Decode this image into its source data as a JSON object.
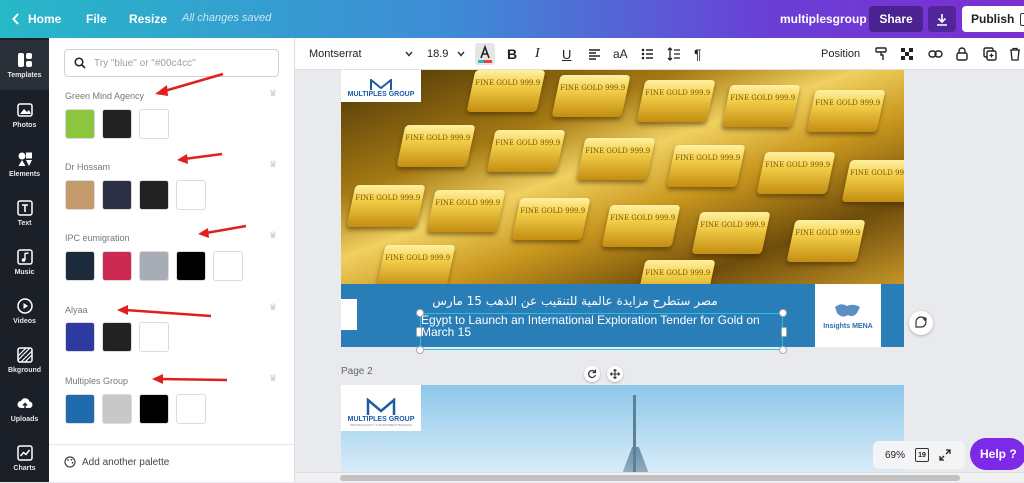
{
  "topbar": {
    "home_label": "Home",
    "file_label": "File",
    "resize_label": "Resize",
    "save_status": "All changes saved",
    "project_name": "multiplesgroup",
    "share_label": "Share",
    "publish_label": "Publish"
  },
  "rail": [
    {
      "label": "Templates",
      "icon": "templates-icon"
    },
    {
      "label": "Photos",
      "icon": "photos-icon"
    },
    {
      "label": "Elements",
      "icon": "elements-icon"
    },
    {
      "label": "Text",
      "icon": "text-icon"
    },
    {
      "label": "Music",
      "icon": "music-icon"
    },
    {
      "label": "Videos",
      "icon": "videos-icon"
    },
    {
      "label": "Bkground",
      "icon": "background-icon"
    },
    {
      "label": "Uploads",
      "icon": "uploads-icon"
    },
    {
      "label": "Charts",
      "icon": "charts-icon"
    }
  ],
  "panel": {
    "search_placeholder": "Try \"blue\" or \"#00c4cc\"",
    "add_palette_label": "Add another palette",
    "palettes": [
      {
        "name": "Green Mind Agency",
        "colors": [
          "#8cc63f",
          "#222222",
          "#ffffff"
        ]
      },
      {
        "name": "Dr Hossam",
        "colors": [
          "#c49a6c",
          "#2b3046",
          "#222222",
          "#ffffff"
        ]
      },
      {
        "name": "IPC eumigration",
        "colors": [
          "#1c2a3c",
          "#cc2a52",
          "#a8adb5",
          "#000000",
          "#ffffff"
        ]
      },
      {
        "name": "Alyaa",
        "colors": [
          "#2d3aa0",
          "#222222",
          "#ffffff"
        ]
      },
      {
        "name": "Multiples Group",
        "colors": [
          "#1f6aab",
          "#c8c8c8",
          "#000000",
          "#ffffff"
        ]
      }
    ],
    "annotation_color": "#e02020"
  },
  "toolbar": {
    "font": "Montserrat",
    "font_size": "18.9",
    "position_label": "Position"
  },
  "canvas": {
    "logo_text": "MULTIPLES GROUP",
    "logo_sub": "PRIVATE EQUITY & INVESTMENT BANKING",
    "gold_bar_text": "FINE GOLD 999.9",
    "headline_arabic": "مصر ستطرح مزايدة عالمية للتنقيب عن الذهب 15 مارس",
    "headline_english": "Egypt to Launch an International Exploration Tender for Gold on March 15",
    "banner_logo_text": "Insights MENA",
    "page2_label": "Page 2"
  },
  "bottom": {
    "zoom": "69%",
    "page_count": "19",
    "help_label": "Help ?"
  }
}
